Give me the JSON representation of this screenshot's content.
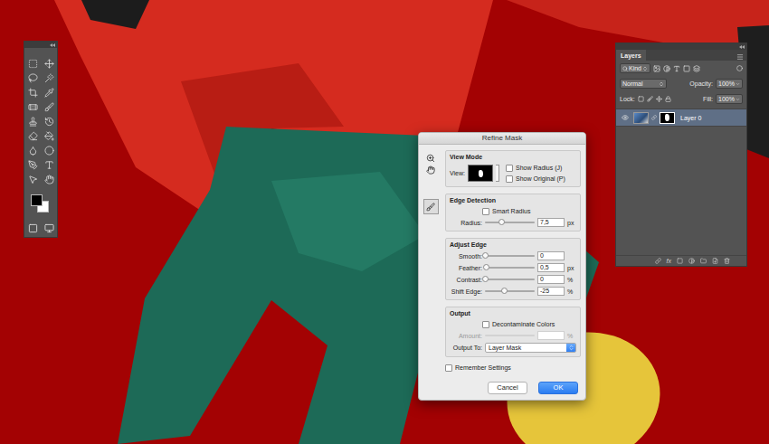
{
  "tools_panel": {
    "swatches": {
      "foreground": "#000000",
      "background": "#ffffff"
    }
  },
  "layers_panel": {
    "title": "Layers",
    "filter": "Kind",
    "blend_mode": "Normal",
    "opacity_label": "Opacity:",
    "opacity": "100%",
    "lock_label": "Lock:",
    "fill_label": "Fill:",
    "fill": "100%",
    "layers": [
      {
        "name": "Layer 0",
        "visible": true,
        "selected": true
      }
    ],
    "footer_fx": "fx"
  },
  "dialog": {
    "title": "Refine Mask",
    "view_mode": {
      "heading": "View Mode",
      "view_label": "View:",
      "options": [
        {
          "label": "Show Radius (J)",
          "checked": false
        },
        {
          "label": "Show Original (P)",
          "checked": false
        }
      ]
    },
    "edge_detection": {
      "heading": "Edge Detection",
      "smart_radius": {
        "label": "Smart Radius",
        "checked": false
      },
      "sliders": [
        {
          "label": "Radius:",
          "value": "7,5",
          "unit": "px",
          "level": 0.33,
          "disabled": false
        }
      ]
    },
    "adjust_edge": {
      "heading": "Adjust Edge",
      "sliders": [
        {
          "label": "Smooth:",
          "value": "0",
          "unit": "",
          "level": 0,
          "disabled": false
        },
        {
          "label": "Feather:",
          "value": "0,5",
          "unit": "px",
          "level": 0.02,
          "disabled": false
        },
        {
          "label": "Contrast:",
          "value": "0",
          "unit": "%",
          "level": 0,
          "disabled": false
        },
        {
          "label": "Shift Edge:",
          "value": "-25",
          "unit": "%",
          "level": 0.375,
          "disabled": false
        }
      ]
    },
    "output": {
      "heading": "Output",
      "decontaminate": {
        "label": "Decontaminate Colors",
        "checked": false
      },
      "amount": {
        "label": "Amount:",
        "value": "",
        "unit": "%",
        "disabled": true
      },
      "output_to_label": "Output To:",
      "output_to": "Layer Mask"
    },
    "remember": {
      "label": "Remember Settings",
      "checked": false
    },
    "buttons": [
      {
        "label": "Cancel",
        "default": false
      },
      {
        "label": "OK",
        "default": true
      }
    ]
  }
}
